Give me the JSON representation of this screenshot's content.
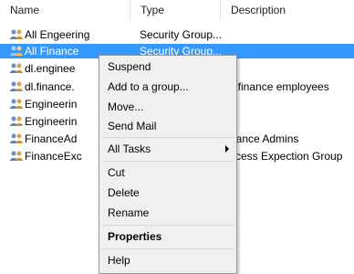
{
  "columns": {
    "name": "Name",
    "type": "Type",
    "description": "Description"
  },
  "rows": [
    {
      "name": "All Engeering",
      "type": "Security Group...",
      "description": ""
    },
    {
      "name": "All Finance",
      "type": "Security Group...",
      "description": ""
    },
    {
      "name": "dl.enginee",
      "type": "",
      "description": ""
    },
    {
      "name": "dl.finance.",
      "type": "",
      "description": "ll finance employees"
    },
    {
      "name": "Engineerin",
      "type": "",
      "description": ""
    },
    {
      "name": "Engineerin",
      "type": "",
      "description": ""
    },
    {
      "name": "FinanceAd",
      "type": "",
      "description": "nance Admins"
    },
    {
      "name": "FinanceExc",
      "type": "",
      "description": "ccess Expection Group"
    }
  ],
  "selected_row": "All Finance",
  "context_menu": {
    "suspend": "Suspend",
    "add_to_group": "Add to a group...",
    "move": "Move...",
    "send_mail": "Send Mail",
    "all_tasks": "All Tasks",
    "cut": "Cut",
    "delete": "Delete",
    "rename": "Rename",
    "properties": "Properties",
    "help": "Help"
  },
  "colors": {
    "selection": "#3399ff",
    "menu_bg": "#f0f0f0",
    "menu_border": "#979797"
  },
  "icons": {
    "group": "group-users-icon",
    "submenu": "submenu-arrow-icon"
  }
}
